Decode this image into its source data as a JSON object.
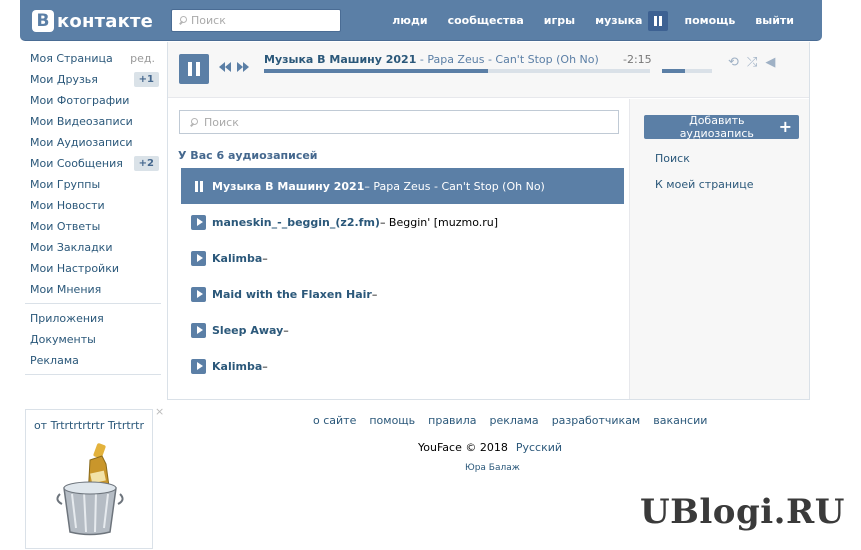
{
  "header": {
    "logo_letter": "В",
    "logo_text": "контакте",
    "search_placeholder": "Поиск",
    "nav": [
      "люди",
      "сообщества",
      "игры",
      "музыка",
      "помощь",
      "выйти"
    ]
  },
  "leftmenu": {
    "main": [
      {
        "label": "Моя Страница",
        "extra": "ред."
      },
      {
        "label": "Мои Друзья",
        "badge": "+1"
      },
      {
        "label": "Мои Фотографии"
      },
      {
        "label": "Мои Видеозаписи"
      },
      {
        "label": "Мои Аудиозаписи"
      },
      {
        "label": "Мои Сообщения",
        "badge": "+2"
      },
      {
        "label": "Мои Группы"
      },
      {
        "label": "Мои Новости"
      },
      {
        "label": "Мои Ответы"
      },
      {
        "label": "Мои Закладки"
      },
      {
        "label": "Мои Настройки"
      },
      {
        "label": "Мои Мнения"
      }
    ],
    "secondary": [
      "Приложения",
      "Документы",
      "Реклама"
    ]
  },
  "ad": {
    "title": "от Trtrtrtrtrtr Trtrtrtr",
    "close": "×"
  },
  "player": {
    "track_title": "Музыка В Машину 2021",
    "track_artist": " - Papa Zeus - Can't Stop (Oh No)",
    "time": "-2:15",
    "progress": 0.58,
    "volume": 0.45
  },
  "audio": {
    "search_placeholder": "Поиск",
    "count_label": "У Вас 6 аудиозаписей",
    "tracks": [
      {
        "title": "Музыка В Машину 2021",
        "artist": " – Papa Zeus - Can't Stop (Oh No)",
        "active": true
      },
      {
        "title": "maneskin_-_beggin_(z2.fm)",
        "artist": " – Beggin' [muzmo.ru]"
      },
      {
        "title": "Kalimba",
        "artist": " –"
      },
      {
        "title": "Maid with the Flaxen Hair",
        "artist": " –"
      },
      {
        "title": "Sleep Away",
        "artist": " –"
      },
      {
        "title": "Kalimba",
        "artist": " –"
      }
    ]
  },
  "rightcol": {
    "add_label": "Добавить аудиозапись",
    "links": [
      "Поиск",
      "К моей странице"
    ]
  },
  "footer": {
    "links": [
      "о сайте",
      "помощь",
      "правила",
      "реклама",
      "разработчикам",
      "вакансии"
    ],
    "copyright": "YouFace © 2018",
    "language": "Русский",
    "author": "Юра Балаж"
  },
  "watermark": "UBlogi.RU",
  "colors": {
    "accent": "#5b7fa6",
    "link": "#2b587a"
  }
}
